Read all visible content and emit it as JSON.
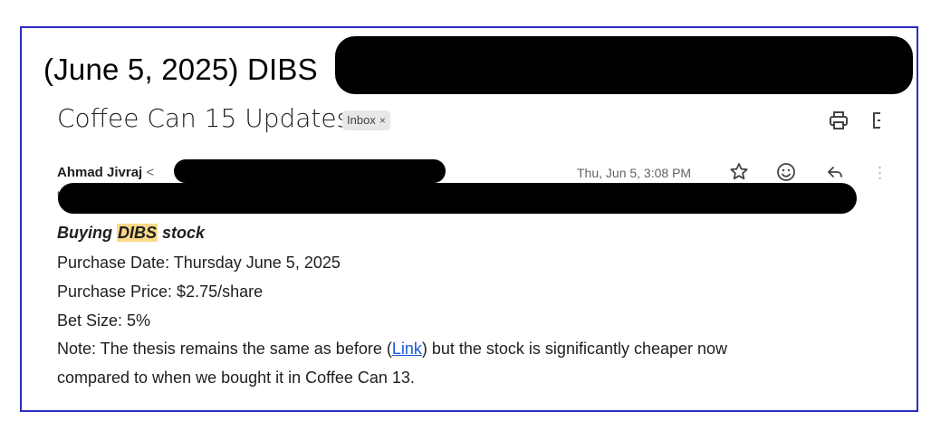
{
  "headline": {
    "text": "(June 5, 2025) DIBS"
  },
  "email": {
    "subject": "Coffee Can 15 Updates",
    "label_chip": "Inbox",
    "label_chip_close": "×",
    "sender_name": "Ahmad Jivraj",
    "sender_lt": "<",
    "to_prefix": "t",
    "date": "Thu, Jun 5, 3:08 PM",
    "body": {
      "title_prefix": "Buying ",
      "title_highlight": "DIBS",
      "title_suffix": " stock",
      "purchase_date": "Purchase Date: Thursday June 5, 2025",
      "purchase_price": "Purchase Price: $2.75/share",
      "bet_size": "Bet Size: 5%",
      "note_prefix": "Note: The thesis remains the same as before (",
      "note_link": "Link",
      "note_suffix": ") but the stock is significantly cheaper now",
      "note_line2": "compared to when we bought it in Coffee Can 13."
    }
  },
  "colors": {
    "frame_border": "#2c2cc8",
    "highlight": "#fbd98a",
    "link": "#1a57d6"
  },
  "icons": [
    "print-icon",
    "open-in-new-window-icon",
    "star-icon",
    "emoji-icon",
    "reply-icon",
    "more-vert-icon"
  ]
}
